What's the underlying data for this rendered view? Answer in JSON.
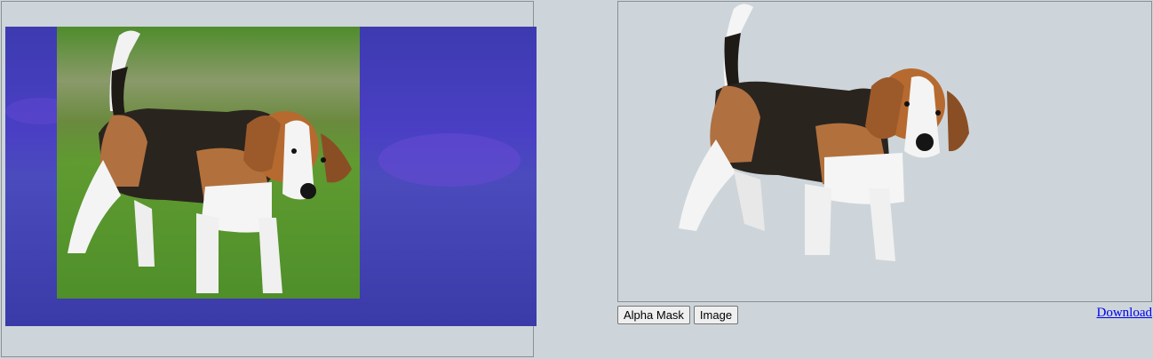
{
  "left_panel": {
    "image": "beagle-on-grass-with-blue-mask-overlay"
  },
  "right_panel": {
    "image": "beagle-cutout-on-gray-background"
  },
  "controls": {
    "alpha_mask_label": "Alpha Mask",
    "image_label": "Image",
    "download_label": "Download"
  },
  "colors": {
    "background": "#cdd5da",
    "mask_overlay": "#3a32c8",
    "grass": "#5a9a35",
    "link": "#0000ee"
  }
}
